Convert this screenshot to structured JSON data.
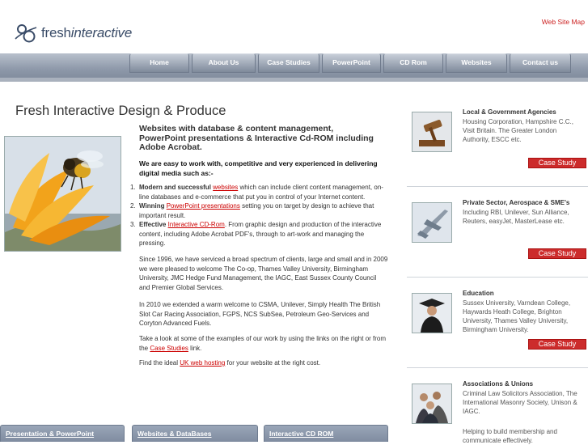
{
  "header": {
    "logo_fresh": "fresh",
    "logo_interactive": "interactive",
    "top_links": [
      "Web Site Map"
    ]
  },
  "nav": {
    "tabs": [
      "Home",
      "About Us",
      "Case Studies",
      "PowerPoint",
      "CD Rom",
      "Websites",
      "Contact us"
    ]
  },
  "main": {
    "title": "Fresh Interactive Design & Produce",
    "intro": "Websites with database & content management, PowerPoint presentations & Interactive Cd-ROM including Adobe Acrobat.",
    "intro2": "We are easy to work with, competitive and very experienced in delivering digital media such as:-",
    "features": [
      {
        "num": "1.",
        "lead": "Modern and successful ",
        "link": "websites",
        "rest": " which can include client content management, on-line databases and e-commerce that put you in control of your Internet content."
      },
      {
        "num": "2.",
        "lead": "Winning ",
        "link": "PowerPoint presentations",
        "rest": " setting you on target by design to achieve that important result."
      },
      {
        "num": "3.",
        "lead": "Effective ",
        "link": "Interactive CD-Rom",
        "rest": ". From graphic design and production of the interactive content, including Adobe Acrobat PDF's, through to art-work and managing the pressing."
      }
    ],
    "para1": "Since 1996, we have serviced a broad spectrum of clients, large and small and in 2009 we were pleased to welcome The Co-op, Thames Valley University, Birmingham University, JMC Hedge Fund Management, the IAGC, East Sussex County Council and Premier Global Services.",
    "para2": "In 2010 we extended a warm welcome to CSMA, Unilever, Simply Health The British Slot Car Racing Association, FGPS, NCS SubSea, Petroleum Geo-Services and Coryton Advanced Fuels.",
    "para3_a": "Take a look at some of the examples of our work by using the links on the right or from the ",
    "para3_link": "Case Studies",
    "para3_b": " link.",
    "para4_a": "Find the ideal ",
    "para4_link": "UK web hosting",
    "para4_b": " for your website at the right cost."
  },
  "sidebar": [
    {
      "title": "Local & Government Agencies",
      "desc": "Housing Corporation, Hampshire C.C., Visit Britain. The Greater London Authority, ESCC etc.",
      "button": "Case Study",
      "icon": "gavel-icon"
    },
    {
      "title": "Private Sector, Aerospace & SME's",
      "desc": "Including RBI, Unilever, Sun Alliance, Reuters, easyJet, MasterLease etc.",
      "button": "Case Study",
      "icon": "jet-icon"
    },
    {
      "title": "Education",
      "desc": "Sussex University, Varndean College, Haywards Heath College, Brighton University, Thames Valley University, Birmingham University.",
      "button": "Case Study",
      "icon": "graduate-icon"
    },
    {
      "title": "Associations & Unions",
      "desc": "Criminal Law Solicitors Association, The International Masonry Society, Unison & IAGC.",
      "desc2": "Helping to build membership and communicate effectively.",
      "icon": "group-icon"
    }
  ],
  "bottom_tabs": [
    "Presentation & PowerPoint",
    "Websites & DataBases",
    "Interactive CD ROM"
  ]
}
